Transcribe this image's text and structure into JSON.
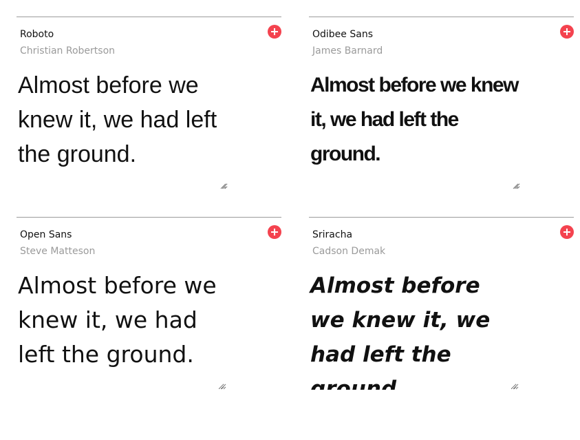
{
  "cards": [
    {
      "font_name": "Roboto",
      "designer": "Christian Robertson",
      "sample_text": "Almost before we knew it, we had left the ground."
    },
    {
      "font_name": "Odibee Sans",
      "designer": "James Barnard",
      "sample_text": "Almost before we knew it, we had left the ground."
    },
    {
      "font_name": "Open Sans",
      "designer": "Steve Matteson",
      "sample_text": "Almost before we knew it, we had left the ground."
    },
    {
      "font_name": "Sriracha",
      "designer": "Cadson Demak",
      "sample_text": "Almost before we knew it, we had left the ground."
    }
  ],
  "colors": {
    "accent": "#f4434f",
    "divider": "#9a9a9a",
    "designer_text": "#9a9a9a",
    "text": "#111111"
  },
  "icons": {
    "add": "plus-circle-icon",
    "resize": "resize-grip-icon"
  }
}
